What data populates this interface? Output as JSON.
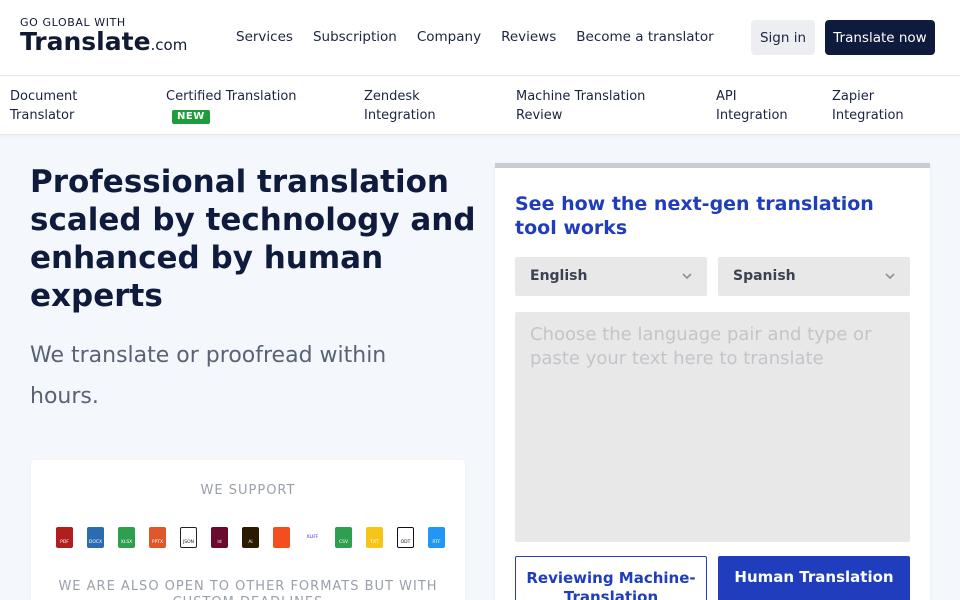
{
  "header": {
    "tagline": "GO GLOBAL WITH",
    "brand_name": "Translate",
    "brand_tld": ".com",
    "nav": [
      "Services",
      "Subscription",
      "Company",
      "Reviews",
      "Become a translator"
    ],
    "signin_label": "Sign in",
    "cta_label": "Translate now"
  },
  "subnav": [
    {
      "line1": "Document",
      "line2": "Translator"
    },
    {
      "line1": "Certified Translation",
      "badge": "NEW"
    },
    {
      "line1": "Zendesk",
      "line2": "Integration"
    },
    {
      "line1": "Machine Translation",
      "line2": "Review"
    },
    {
      "line1": "API",
      "line2": "Integration"
    },
    {
      "line1": "Zapier",
      "line2": "Integration"
    }
  ],
  "hero": {
    "title": "Professional translation scaled by technology and enhanced by human experts",
    "subtitle": "We translate or proofread within hours."
  },
  "support": {
    "title": "WE SUPPORT",
    "formats": [
      {
        "icon": "pdf-file-icon",
        "label": "PDF",
        "color": "#b01e1e"
      },
      {
        "icon": "docx-file-icon",
        "label": "DOCX",
        "color": "#2b6cb0"
      },
      {
        "icon": "xlsx-file-icon",
        "label": "XLSX",
        "color": "#2e9e4f"
      },
      {
        "icon": "pptx-file-icon",
        "label": "PPTX",
        "color": "#e0572a"
      },
      {
        "icon": "json-file-icon",
        "label": "JSON",
        "color": "#222222"
      },
      {
        "icon": "indesign-file-icon",
        "label": "Id",
        "color": "#6b0a2c"
      },
      {
        "icon": "illustrator-file-icon",
        "label": "Ai",
        "color": "#2b1a00"
      },
      {
        "icon": "figma-file-icon",
        "label": "",
        "color": "#f24e1e"
      },
      {
        "icon": "xliff-file-icon",
        "label": "XLIFF",
        "color": "#3a2bd6"
      },
      {
        "icon": "csv-file-icon",
        "label": "CSV",
        "color": "#2e9e4f"
      },
      {
        "icon": "txt-file-icon",
        "label": "TXT",
        "color": "#f5c518"
      },
      {
        "icon": "odt-file-icon",
        "label": "ODT",
        "color": "#111111"
      },
      {
        "icon": "rtf-file-icon",
        "label": "RTF",
        "color": "#2196f3"
      }
    ],
    "note": "WE ARE ALSO OPEN TO OTHER FORMATS BUT WITH CUSTOM DEADLINES"
  },
  "tool": {
    "title": "See how the next-gen translation tool works",
    "source_lang": "English",
    "target_lang": "Spanish",
    "placeholder": "Choose the language pair and type or paste your text here to translate",
    "mode_review": "Reviewing Machine-Translation",
    "mode_human": "Human Translation"
  }
}
